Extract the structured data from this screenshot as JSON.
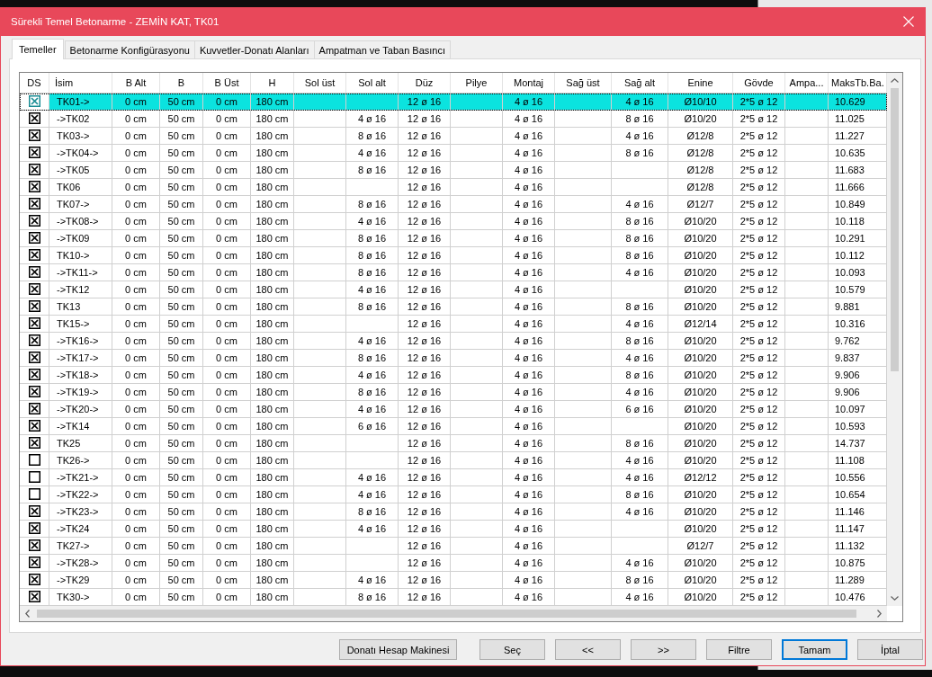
{
  "window": {
    "title": "Sürekli Temel Betonarme - ZEMİN KAT, TK01"
  },
  "tabs": [
    {
      "label": "Temeller",
      "selected": true
    },
    {
      "label": "Betonarme Konfigürasyonu",
      "selected": false
    },
    {
      "label": "Kuvvetler-Donatı Alanları",
      "selected": false
    },
    {
      "label": "Ampatman ve Taban Basıncı",
      "selected": false
    }
  ],
  "table": {
    "checkbox_column": "DS",
    "columns": [
      "İsim",
      "B Alt",
      "B",
      "B Üst",
      "H",
      "Sol üst",
      "Sol alt",
      "Düz",
      "Pilye",
      "Montaj",
      "Sağ üst",
      "Sağ alt",
      "Enine",
      "Gövde",
      "Ampa...",
      "MaksTb.Ba."
    ],
    "rows": [
      {
        "selected": true,
        "checked": true,
        "cells": [
          "TK01->",
          "0 cm",
          "50 cm",
          "0 cm",
          "180 cm",
          null,
          null,
          "12 ø 16",
          null,
          "4 ø 16",
          null,
          "4 ø 16",
          "Ø10/10",
          "2*5 ø 12",
          null,
          "10.629"
        ]
      },
      {
        "selected": false,
        "checked": true,
        "cells": [
          "->TK02",
          "0 cm",
          "50 cm",
          "0 cm",
          "180 cm",
          null,
          "4 ø 16",
          "12 ø 16",
          null,
          "4 ø 16",
          null,
          "8 ø 16",
          "Ø10/20",
          "2*5 ø 12",
          null,
          "11.025"
        ]
      },
      {
        "selected": false,
        "checked": true,
        "cells": [
          "TK03->",
          "0 cm",
          "50 cm",
          "0 cm",
          "180 cm",
          null,
          "8 ø 16",
          "12 ø 16",
          null,
          "4 ø 16",
          null,
          "4 ø 16",
          "Ø12/8",
          "2*5 ø 12",
          null,
          "11.227"
        ]
      },
      {
        "selected": false,
        "checked": true,
        "cells": [
          "->TK04->",
          "0 cm",
          "50 cm",
          "0 cm",
          "180 cm",
          null,
          "4 ø 16",
          "12 ø 16",
          null,
          "4 ø 16",
          null,
          "8 ø 16",
          "Ø12/8",
          "2*5 ø 12",
          null,
          "10.635"
        ]
      },
      {
        "selected": false,
        "checked": true,
        "cells": [
          "->TK05",
          "0 cm",
          "50 cm",
          "0 cm",
          "180 cm",
          null,
          "8 ø 16",
          "12 ø 16",
          null,
          "4 ø 16",
          null,
          null,
          "Ø12/8",
          "2*5 ø 12",
          null,
          "11.683"
        ]
      },
      {
        "selected": false,
        "checked": true,
        "cells": [
          "TK06",
          "0 cm",
          "50 cm",
          "0 cm",
          "180 cm",
          null,
          null,
          "12 ø 16",
          null,
          "4 ø 16",
          null,
          null,
          "Ø12/8",
          "2*5 ø 12",
          null,
          "11.666"
        ]
      },
      {
        "selected": false,
        "checked": true,
        "cells": [
          "TK07->",
          "0 cm",
          "50 cm",
          "0 cm",
          "180 cm",
          null,
          "8 ø 16",
          "12 ø 16",
          null,
          "4 ø 16",
          null,
          "4 ø 16",
          "Ø12/7",
          "2*5 ø 12",
          null,
          "10.849"
        ]
      },
      {
        "selected": false,
        "checked": true,
        "cells": [
          "->TK08->",
          "0 cm",
          "50 cm",
          "0 cm",
          "180 cm",
          null,
          "4 ø 16",
          "12 ø 16",
          null,
          "4 ø 16",
          null,
          "8 ø 16",
          "Ø10/20",
          "2*5 ø 12",
          null,
          "10.118"
        ]
      },
      {
        "selected": false,
        "checked": true,
        "cells": [
          "->TK09",
          "0 cm",
          "50 cm",
          "0 cm",
          "180 cm",
          null,
          "8 ø 16",
          "12 ø 16",
          null,
          "4 ø 16",
          null,
          "8 ø 16",
          "Ø10/20",
          "2*5 ø 12",
          null,
          "10.291"
        ]
      },
      {
        "selected": false,
        "checked": true,
        "cells": [
          "TK10->",
          "0 cm",
          "50 cm",
          "0 cm",
          "180 cm",
          null,
          "8 ø 16",
          "12 ø 16",
          null,
          "4 ø 16",
          null,
          "8 ø 16",
          "Ø10/20",
          "2*5 ø 12",
          null,
          "10.112"
        ]
      },
      {
        "selected": false,
        "checked": true,
        "cells": [
          "->TK11->",
          "0 cm",
          "50 cm",
          "0 cm",
          "180 cm",
          null,
          "8 ø 16",
          "12 ø 16",
          null,
          "4 ø 16",
          null,
          "4 ø 16",
          "Ø10/20",
          "2*5 ø 12",
          null,
          "10.093"
        ]
      },
      {
        "selected": false,
        "checked": true,
        "cells": [
          "->TK12",
          "0 cm",
          "50 cm",
          "0 cm",
          "180 cm",
          null,
          "4 ø 16",
          "12 ø 16",
          null,
          "4 ø 16",
          null,
          null,
          "Ø10/20",
          "2*5 ø 12",
          null,
          "10.579"
        ]
      },
      {
        "selected": false,
        "checked": true,
        "cells": [
          "TK13",
          "0 cm",
          "50 cm",
          "0 cm",
          "180 cm",
          null,
          "8 ø 16",
          "12 ø 16",
          null,
          "4 ø 16",
          null,
          "8 ø 16",
          "Ø10/20",
          "2*5 ø 12",
          null,
          "9.881"
        ]
      },
      {
        "selected": false,
        "checked": true,
        "cells": [
          "TK15->",
          "0 cm",
          "50 cm",
          "0 cm",
          "180 cm",
          null,
          null,
          "12 ø 16",
          null,
          "4 ø 16",
          null,
          "4 ø 16",
          "Ø12/14",
          "2*5 ø 12",
          null,
          "10.316"
        ]
      },
      {
        "selected": false,
        "checked": true,
        "cells": [
          "->TK16->",
          "0 cm",
          "50 cm",
          "0 cm",
          "180 cm",
          null,
          "4 ø 16",
          "12 ø 16",
          null,
          "4 ø 16",
          null,
          "8 ø 16",
          "Ø10/20",
          "2*5 ø 12",
          null,
          "9.762"
        ]
      },
      {
        "selected": false,
        "checked": true,
        "cells": [
          "->TK17->",
          "0 cm",
          "50 cm",
          "0 cm",
          "180 cm",
          null,
          "8 ø 16",
          "12 ø 16",
          null,
          "4 ø 16",
          null,
          "4 ø 16",
          "Ø10/20",
          "2*5 ø 12",
          null,
          "9.837"
        ]
      },
      {
        "selected": false,
        "checked": true,
        "cells": [
          "->TK18->",
          "0 cm",
          "50 cm",
          "0 cm",
          "180 cm",
          null,
          "4 ø 16",
          "12 ø 16",
          null,
          "4 ø 16",
          null,
          "8 ø 16",
          "Ø10/20",
          "2*5 ø 12",
          null,
          "9.906"
        ]
      },
      {
        "selected": false,
        "checked": true,
        "cells": [
          "->TK19->",
          "0 cm",
          "50 cm",
          "0 cm",
          "180 cm",
          null,
          "8 ø 16",
          "12 ø 16",
          null,
          "4 ø 16",
          null,
          "4 ø 16",
          "Ø10/20",
          "2*5 ø 12",
          null,
          "9.906"
        ]
      },
      {
        "selected": false,
        "checked": true,
        "cells": [
          "->TK20->",
          "0 cm",
          "50 cm",
          "0 cm",
          "180 cm",
          null,
          "4 ø 16",
          "12 ø 16",
          null,
          "4 ø 16",
          null,
          "6 ø 16",
          "Ø10/20",
          "2*5 ø 12",
          null,
          "10.097"
        ]
      },
      {
        "selected": false,
        "checked": true,
        "cells": [
          "->TK14",
          "0 cm",
          "50 cm",
          "0 cm",
          "180 cm",
          null,
          "6 ø 16",
          "12 ø 16",
          null,
          "4 ø 16",
          null,
          null,
          "Ø10/20",
          "2*5 ø 12",
          null,
          "10.593"
        ]
      },
      {
        "selected": false,
        "checked": true,
        "cells": [
          "TK25",
          "0 cm",
          "50 cm",
          "0 cm",
          "180 cm",
          null,
          null,
          "12 ø 16",
          null,
          "4 ø 16",
          null,
          "8 ø 16",
          "Ø10/20",
          "2*5 ø 12",
          null,
          "14.737"
        ]
      },
      {
        "selected": false,
        "checked": false,
        "cells": [
          "TK26->",
          "0 cm",
          "50 cm",
          "0 cm",
          "180 cm",
          null,
          null,
          "12 ø 16",
          null,
          "4 ø 16",
          null,
          "4 ø 16",
          "Ø10/20",
          "2*5 ø 12",
          null,
          "11.108"
        ]
      },
      {
        "selected": false,
        "checked": false,
        "cells": [
          "->TK21->",
          "0 cm",
          "50 cm",
          "0 cm",
          "180 cm",
          null,
          "4 ø 16",
          "12 ø 16",
          null,
          "4 ø 16",
          null,
          "4 ø 16",
          "Ø12/12",
          "2*5 ø 12",
          null,
          "10.556"
        ]
      },
      {
        "selected": false,
        "checked": false,
        "cells": [
          "->TK22->",
          "0 cm",
          "50 cm",
          "0 cm",
          "180 cm",
          null,
          "4 ø 16",
          "12 ø 16",
          null,
          "4 ø 16",
          null,
          "8 ø 16",
          "Ø10/20",
          "2*5 ø 12",
          null,
          "10.654"
        ]
      },
      {
        "selected": false,
        "checked": true,
        "cells": [
          "->TK23->",
          "0 cm",
          "50 cm",
          "0 cm",
          "180 cm",
          null,
          "8 ø 16",
          "12 ø 16",
          null,
          "4 ø 16",
          null,
          "4 ø 16",
          "Ø10/20",
          "2*5 ø 12",
          null,
          "11.146"
        ]
      },
      {
        "selected": false,
        "checked": true,
        "cells": [
          "->TK24",
          "0 cm",
          "50 cm",
          "0 cm",
          "180 cm",
          null,
          "4 ø 16",
          "12 ø 16",
          null,
          "4 ø 16",
          null,
          null,
          "Ø10/20",
          "2*5 ø 12",
          null,
          "11.147"
        ]
      },
      {
        "selected": false,
        "checked": true,
        "cells": [
          "TK27->",
          "0 cm",
          "50 cm",
          "0 cm",
          "180 cm",
          null,
          null,
          "12 ø 16",
          null,
          "4 ø 16",
          null,
          null,
          "Ø12/7",
          "2*5 ø 12",
          null,
          "11.132"
        ]
      },
      {
        "selected": false,
        "checked": true,
        "cells": [
          "->TK28->",
          "0 cm",
          "50 cm",
          "0 cm",
          "180 cm",
          null,
          null,
          "12 ø 16",
          null,
          "4 ø 16",
          null,
          "4 ø 16",
          "Ø10/20",
          "2*5 ø 12",
          null,
          "10.875"
        ]
      },
      {
        "selected": false,
        "checked": true,
        "cells": [
          "->TK29",
          "0 cm",
          "50 cm",
          "0 cm",
          "180 cm",
          null,
          "4 ø 16",
          "12 ø 16",
          null,
          "4 ø 16",
          null,
          "8 ø 16",
          "Ø10/20",
          "2*5 ø 12",
          null,
          "11.289"
        ]
      },
      {
        "selected": false,
        "checked": true,
        "cells": [
          "TK30->",
          "0 cm",
          "50 cm",
          "0 cm",
          "180 cm",
          null,
          "8 ø 16",
          "12 ø 16",
          null,
          "4 ø 16",
          null,
          "4 ø 16",
          "Ø10/20",
          "2*5 ø 12",
          null,
          "10.476"
        ]
      }
    ]
  },
  "buttons": [
    {
      "label": "Donatı Hesap Makinesi",
      "focused": false
    },
    {
      "label": "Seç",
      "focused": false
    },
    {
      "label": "<<",
      "focused": false
    },
    {
      "label": ">>",
      "focused": false
    },
    {
      "label": "Filtre",
      "focused": false
    },
    {
      "label": "Tamam",
      "focused": true
    },
    {
      "label": "İptal",
      "focused": false
    }
  ]
}
